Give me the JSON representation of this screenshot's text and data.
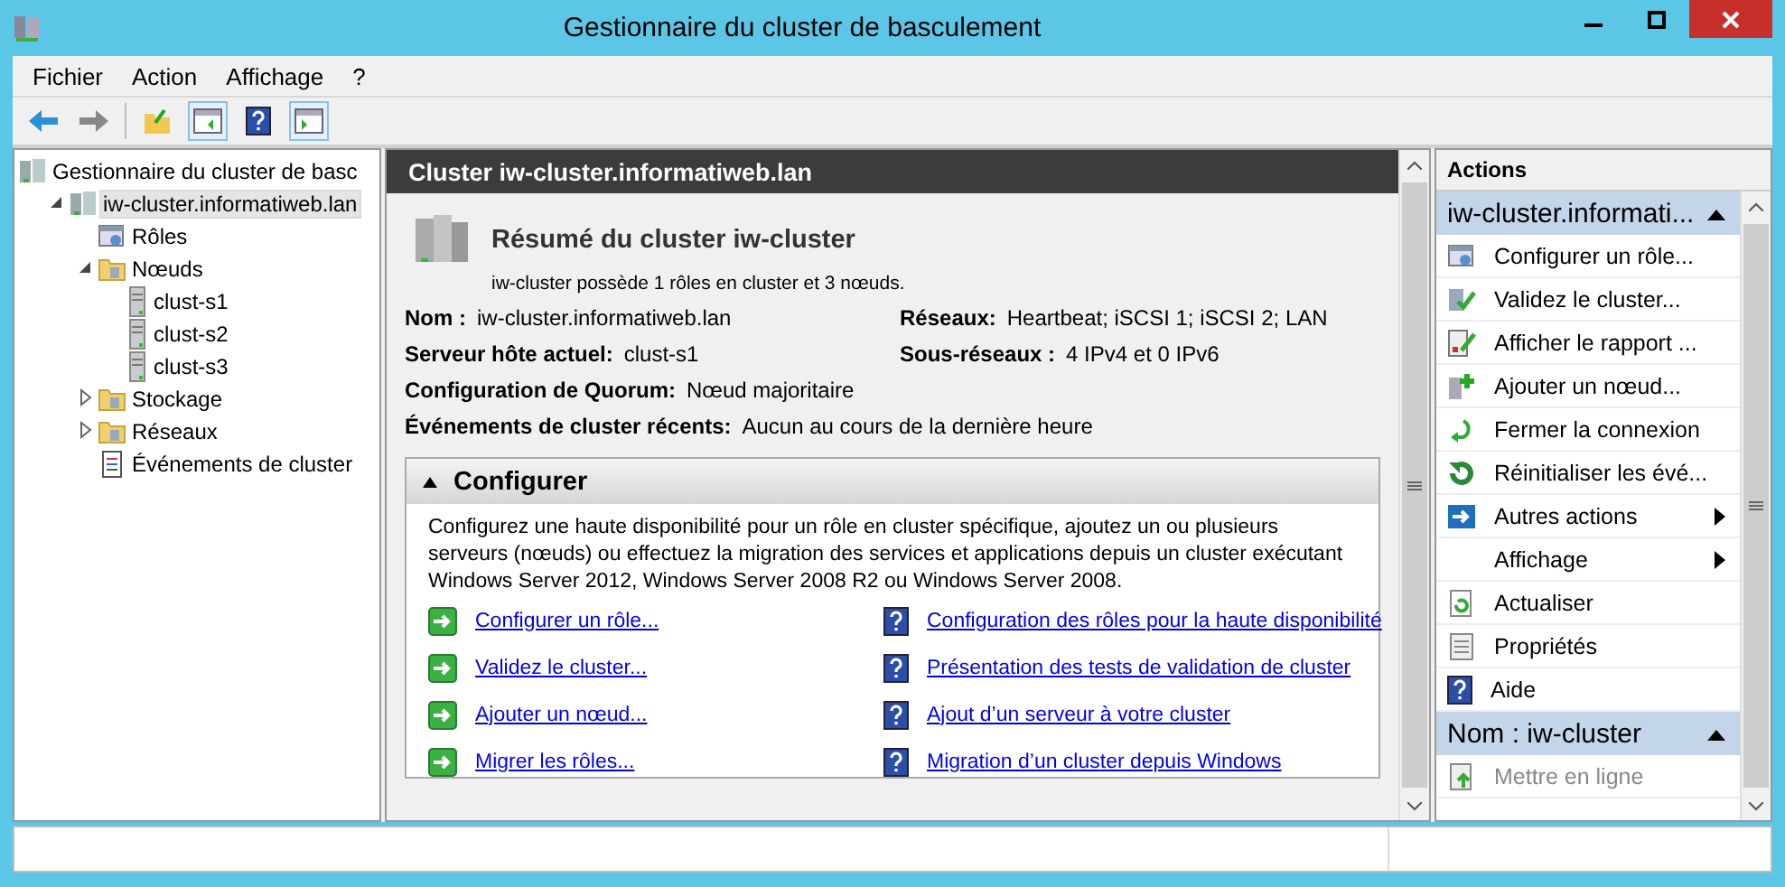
{
  "window": {
    "title": "Gestionnaire du cluster de basculement"
  },
  "menu": [
    {
      "label": "Fichier"
    },
    {
      "label": "Action"
    },
    {
      "label": "Affichage"
    },
    {
      "label": "?"
    }
  ],
  "tree": [
    {
      "label": "Gestionnaire du cluster de basc",
      "kind": "cluster",
      "selected": false,
      "children": [
        {
          "label": "iw-cluster.informatiweb.lan",
          "kind": "cluster",
          "selected": true,
          "expanded": true,
          "children": [
            {
              "label": "Rôles",
              "kind": "roles",
              "selected": false
            },
            {
              "label": "Nœuds",
              "kind": "folder",
              "selected": false,
              "expanded": true,
              "children": [
                {
                  "label": "clust-s1",
                  "kind": "server",
                  "selected": false
                },
                {
                  "label": "clust-s2",
                  "kind": "server",
                  "selected": false
                },
                {
                  "label": "clust-s3",
                  "kind": "server",
                  "selected": false
                }
              ]
            },
            {
              "label": "Stockage",
              "kind": "folder",
              "selected": false,
              "expanded": false,
              "collapsible": true
            },
            {
              "label": "Réseaux",
              "kind": "folder",
              "selected": false,
              "expanded": false,
              "collapsible": true
            },
            {
              "label": "Événements de cluster",
              "kind": "log",
              "selected": false
            }
          ]
        }
      ]
    }
  ],
  "center": {
    "header": "Cluster iw-cluster.informatiweb.lan",
    "summary_title": "Résumé du cluster iw-cluster",
    "summary_text": "iw-cluster possède 1 rôles en cluster et 3 nœuds.",
    "fields": [
      [
        {
          "label": "Nom :",
          "value": "iw-cluster.informatiweb.lan"
        },
        {
          "label": "Réseaux:",
          "value": "Heartbeat; iSCSI 1; iSCSI 2; LAN"
        }
      ],
      [
        {
          "label": "Serveur hôte actuel:",
          "value": "clust-s1"
        },
        {
          "label": "Sous-réseaux :",
          "value": "4 IPv4 et 0 IPv6"
        }
      ],
      [
        {
          "label": "Configuration de Quorum:",
          "value": "Nœud majoritaire"
        }
      ],
      [
        {
          "label": "Événements de cluster récents:",
          "value": "Aucun au cours de la dernière heure"
        }
      ]
    ],
    "section": {
      "title": "Configurer",
      "expanded": true,
      "description": "Configurez une haute disponibilité pour un rôle en cluster spécifique, ajoutez un ou plusieurs serveurs (nœuds) ou effectuez la migration des services et applications depuis un cluster exécutant Windows Server 2012, Windows Server 2008 R2 ou Windows Server 2008.",
      "links": [
        {
          "text": "Configurer un rôle...",
          "kind": "action"
        },
        {
          "text": "Configuration des rôles pour la haute disponibilité",
          "kind": "help"
        },
        {
          "text": "Validez le cluster...",
          "kind": "action"
        },
        {
          "text": "Présentation des tests de validation de cluster",
          "kind": "help"
        },
        {
          "text": "Ajouter un nœud...",
          "kind": "action"
        },
        {
          "text": "Ajout d’un serveur à votre cluster",
          "kind": "help"
        },
        {
          "text": "Migrer les rôles...",
          "kind": "action"
        },
        {
          "text": "Migration d’un cluster depuis Windows",
          "kind": "help"
        }
      ]
    }
  },
  "actions": {
    "header": "Actions",
    "groups": [
      {
        "title": "iw-cluster.informati...",
        "expanded": true,
        "items": [
          {
            "label": "Configurer un rôle...",
            "kind": "roles",
            "submenu": false,
            "disabled": false
          },
          {
            "label": "Validez le cluster...",
            "kind": "validate",
            "submenu": false,
            "disabled": false
          },
          {
            "label": "Afficher le rapport ...",
            "kind": "report",
            "submenu": false,
            "disabled": false
          },
          {
            "label": "Ajouter un nœud...",
            "kind": "add",
            "submenu": false,
            "disabled": false
          },
          {
            "label": "Fermer la connexion",
            "kind": "disconnect",
            "submenu": false,
            "disabled": false
          },
          {
            "label": "Réinitialiser les évé...",
            "kind": "reset",
            "submenu": false,
            "disabled": false
          },
          {
            "label": "Autres actions",
            "kind": "more",
            "submenu": true,
            "disabled": false
          },
          {
            "label": "Affichage",
            "kind": "plain",
            "submenu": true,
            "disabled": false
          },
          {
            "label": "Actualiser",
            "kind": "refresh",
            "submenu": false,
            "disabled": false
          },
          {
            "label": "Propriétés",
            "kind": "props",
            "submenu": false,
            "disabled": false
          },
          {
            "label": "Aide",
            "kind": "help",
            "submenu": false,
            "disabled": false
          }
        ]
      },
      {
        "title": "Nom : iw-cluster",
        "expanded": true,
        "items": [
          {
            "label": "Mettre en ligne",
            "kind": "online",
            "submenu": false,
            "disabled": true
          }
        ]
      }
    ]
  }
}
